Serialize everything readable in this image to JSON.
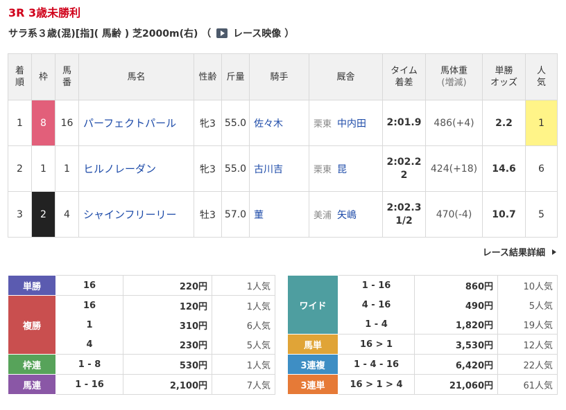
{
  "race": {
    "title": "3R 3歳未勝利",
    "conditions_text": "サラ系３歳(混)[指]( 馬齢 ) 芝2000m(右) （",
    "video_label": "レース映像",
    "conditions_close": "）"
  },
  "results_table": {
    "headers": [
      "着順",
      "枠",
      "馬番",
      "馬名",
      "性齢",
      "斤量",
      "騎手",
      "厩舎",
      "タイム着差",
      "馬体重(増減)",
      "単勝オッズ",
      "人気"
    ],
    "header_lines": [
      [
        "着",
        "順"
      ],
      [
        "枠",
        ""
      ],
      [
        "馬",
        "番"
      ],
      [
        "馬名",
        ""
      ],
      [
        "性齢",
        ""
      ],
      [
        "斤量",
        ""
      ],
      [
        "騎手",
        ""
      ],
      [
        "厩舎",
        ""
      ],
      [
        "タイム",
        "着差"
      ],
      [
        "馬体重",
        "(増減)"
      ],
      [
        "単勝",
        "オッズ"
      ],
      [
        "人",
        "気"
      ]
    ],
    "rows": [
      {
        "rank": "1",
        "waku": "8",
        "num": "16",
        "name": "パーフェクトパール",
        "sex_age": "牝3",
        "weight_carried": "55.0",
        "jockey": "佐々木",
        "region": "栗東",
        "trainer": "中内田",
        "time": "2:01.9",
        "margin": "",
        "body_weight": "486(+4)",
        "odds": "2.2",
        "popularity": "1"
      },
      {
        "rank": "2",
        "waku": "1",
        "num": "1",
        "name": "ヒルノレーダン",
        "sex_age": "牝3",
        "weight_carried": "55.0",
        "jockey": "古川吉",
        "region": "栗東",
        "trainer": "昆",
        "time": "2:02.2",
        "margin": "2",
        "body_weight": "424(+18)",
        "odds": "14.6",
        "popularity": "6"
      },
      {
        "rank": "3",
        "waku": "2",
        "num": "4",
        "name": "シャインフリーリー",
        "sex_age": "牡3",
        "weight_carried": "57.0",
        "jockey": "菫",
        "region": "美浦",
        "trainer": "矢嶋",
        "time": "2:02.3",
        "margin": "1/2",
        "body_weight": "470(-4)",
        "odds": "10.7",
        "popularity": "5"
      }
    ]
  },
  "detail_link_label": "レース結果詳細",
  "payouts_left": [
    {
      "label": "単勝",
      "color": "#5b5bb0",
      "entries": [
        {
          "combo": "16",
          "amount": "220円",
          "pop": "1人気"
        }
      ]
    },
    {
      "label": "複勝",
      "color": "#c94f4f",
      "entries": [
        {
          "combo": "16",
          "amount": "120円",
          "pop": "1人気"
        },
        {
          "combo": "1",
          "amount": "310円",
          "pop": "6人気"
        },
        {
          "combo": "4",
          "amount": "230円",
          "pop": "5人気"
        }
      ]
    },
    {
      "label": "枠連",
      "color": "#57a35a",
      "entries": [
        {
          "combo": "1 - 8",
          "amount": "530円",
          "pop": "1人気"
        }
      ]
    },
    {
      "label": "馬連",
      "color": "#8a57a6",
      "entries": [
        {
          "combo": "1 - 16",
          "amount": "2,100円",
          "pop": "7人気"
        }
      ]
    }
  ],
  "payouts_right": [
    {
      "label": "ワイド",
      "color": "#4e9ea0",
      "entries": [
        {
          "combo": "1 - 16",
          "amount": "860円",
          "pop": "10人気"
        },
        {
          "combo": "4 - 16",
          "amount": "490円",
          "pop": "5人気"
        },
        {
          "combo": "1 - 4",
          "amount": "1,820円",
          "pop": "19人気"
        }
      ]
    },
    {
      "label": "馬単",
      "color": "#e0a437",
      "entries": [
        {
          "combo": "16 > 1",
          "amount": "3,530円",
          "pop": "12人気"
        }
      ]
    },
    {
      "label": "3連複",
      "color": "#3e8ec4",
      "entries": [
        {
          "combo": "1 - 4 - 16",
          "amount": "6,420円",
          "pop": "22人気"
        }
      ]
    },
    {
      "label": "3連単",
      "color": "#e67a37",
      "entries": [
        {
          "combo": "16 > 1 > 4",
          "amount": "21,060円",
          "pop": "61人気"
        }
      ]
    }
  ]
}
